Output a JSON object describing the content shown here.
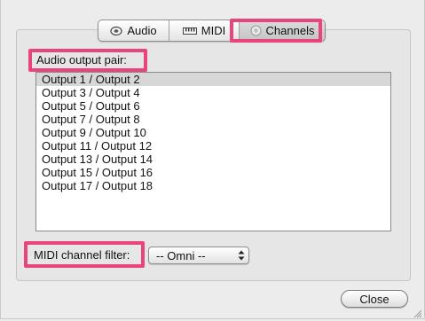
{
  "tabs": [
    {
      "label": "Audio",
      "icon": "speaker-icon",
      "selected": false
    },
    {
      "label": "MIDI",
      "icon": "midi-keyboard-icon",
      "selected": false
    },
    {
      "label": "Channels",
      "icon": "channels-icon",
      "selected": true
    }
  ],
  "audio_output": {
    "label": "Audio output pair:",
    "items": [
      "Output 1 / Output 2",
      "Output 3 / Output 4",
      "Output 5 / Output 6",
      "Output 7 / Output 8",
      "Output 9 / Output 10",
      "Output 11 / Output 12",
      "Output 13 / Output 14",
      "Output 15 / Output 16",
      "Output 17 / Output 18"
    ],
    "selected_index": 0
  },
  "midi_filter": {
    "label": "MIDI channel filter:",
    "value": "-- Omni --"
  },
  "buttons": {
    "close_label": "Close"
  },
  "colors": {
    "highlight": "#e8457a",
    "selection": "#d7d7d7",
    "window_bg": "#ececec"
  }
}
